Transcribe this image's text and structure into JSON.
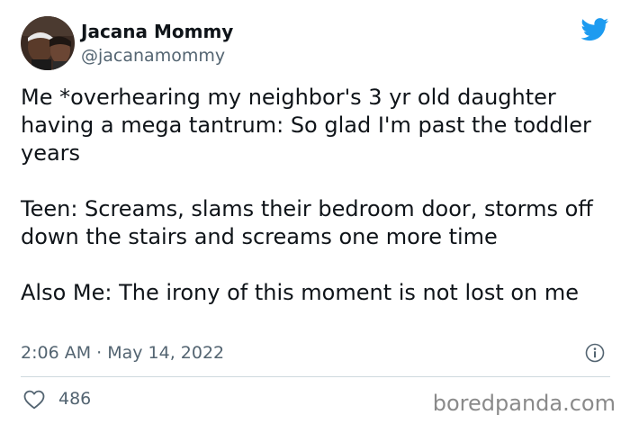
{
  "author": {
    "display_name": "Jacana Mommy",
    "handle": "@jacanamommy"
  },
  "tweet": {
    "paragraphs": [
      "Me *overhearing my neighbor's 3 yr old daughter having a mega tantrum: So glad I'm past the toddler years",
      "Teen: Screams, slams their bedroom door, storms off down the stairs and screams one more time",
      "Also Me: The irony of this moment is not lost on me"
    ],
    "timestamp": "2:06 AM · May 14, 2022",
    "likes": "486"
  },
  "watermark": "boredpanda.com",
  "icons": {
    "platform": "twitter-bird-icon",
    "info": "info-icon",
    "like": "heart-icon"
  },
  "colors": {
    "brand_blue": "#1d9bf0",
    "secondary_text": "#536471",
    "divider": "#cfd9de"
  }
}
